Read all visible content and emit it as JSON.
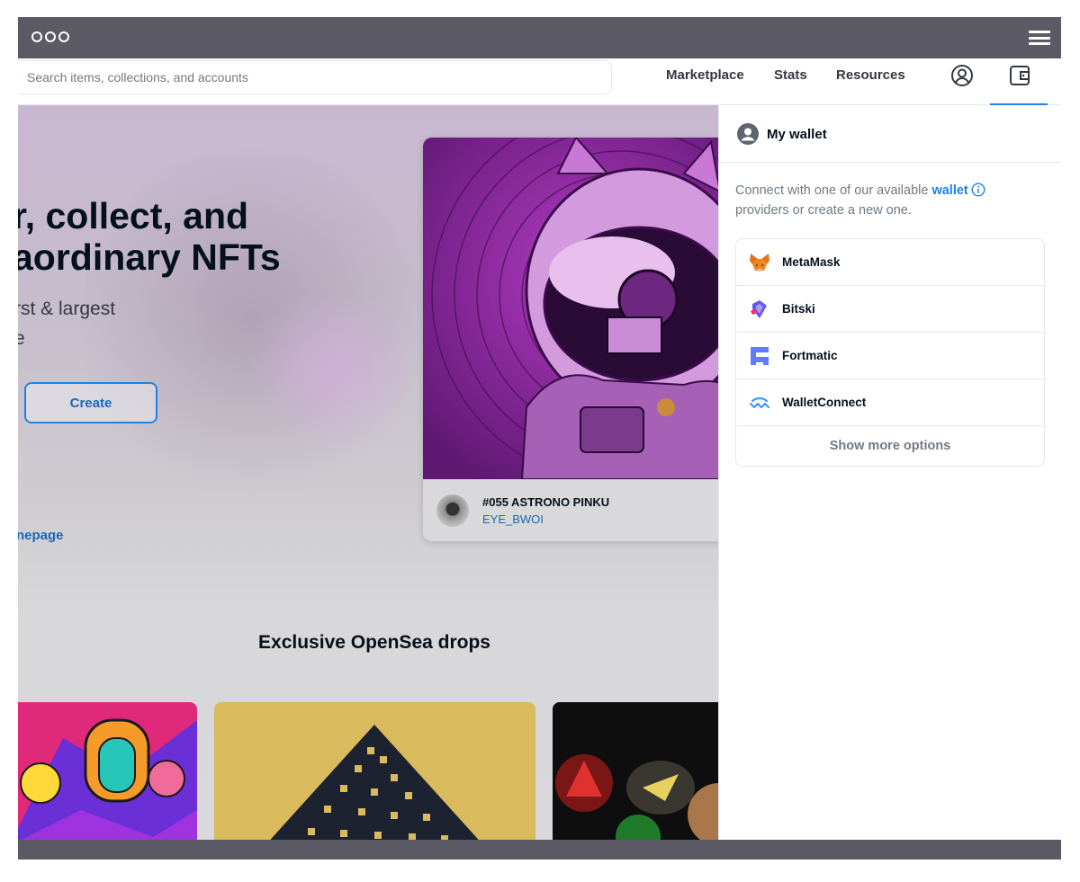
{
  "navbar": {
    "search_placeholder": "Search items, collections, and accounts",
    "links": [
      "Marketplace",
      "Stats",
      "Resources"
    ]
  },
  "hero": {
    "title_line1": "r, collect, and",
    "title_line2": "aordinary NFTs",
    "subtitle_line1": "rst & largest",
    "subtitle_line2": "e",
    "create_label": "Create",
    "homepage_link": "nepage"
  },
  "featured": {
    "name": "#055 ASTRONO PINKU",
    "creator": "EYE_BWOI"
  },
  "drops": {
    "title": "Exclusive OpenSea drops"
  },
  "wallet": {
    "title": "My wallet",
    "desc_before": "Connect with one of our available ",
    "desc_link": "wallet",
    "desc_after": " providers or create a new one.",
    "providers": [
      "MetaMask",
      "Bitski",
      "Fortmatic",
      "WalletConnect"
    ],
    "more_label": "Show more options"
  },
  "colors": {
    "accent": "#2081e2",
    "link": "#1868b7",
    "chrome": "#5b5a65",
    "drop_gold": "#d9ba5c"
  }
}
